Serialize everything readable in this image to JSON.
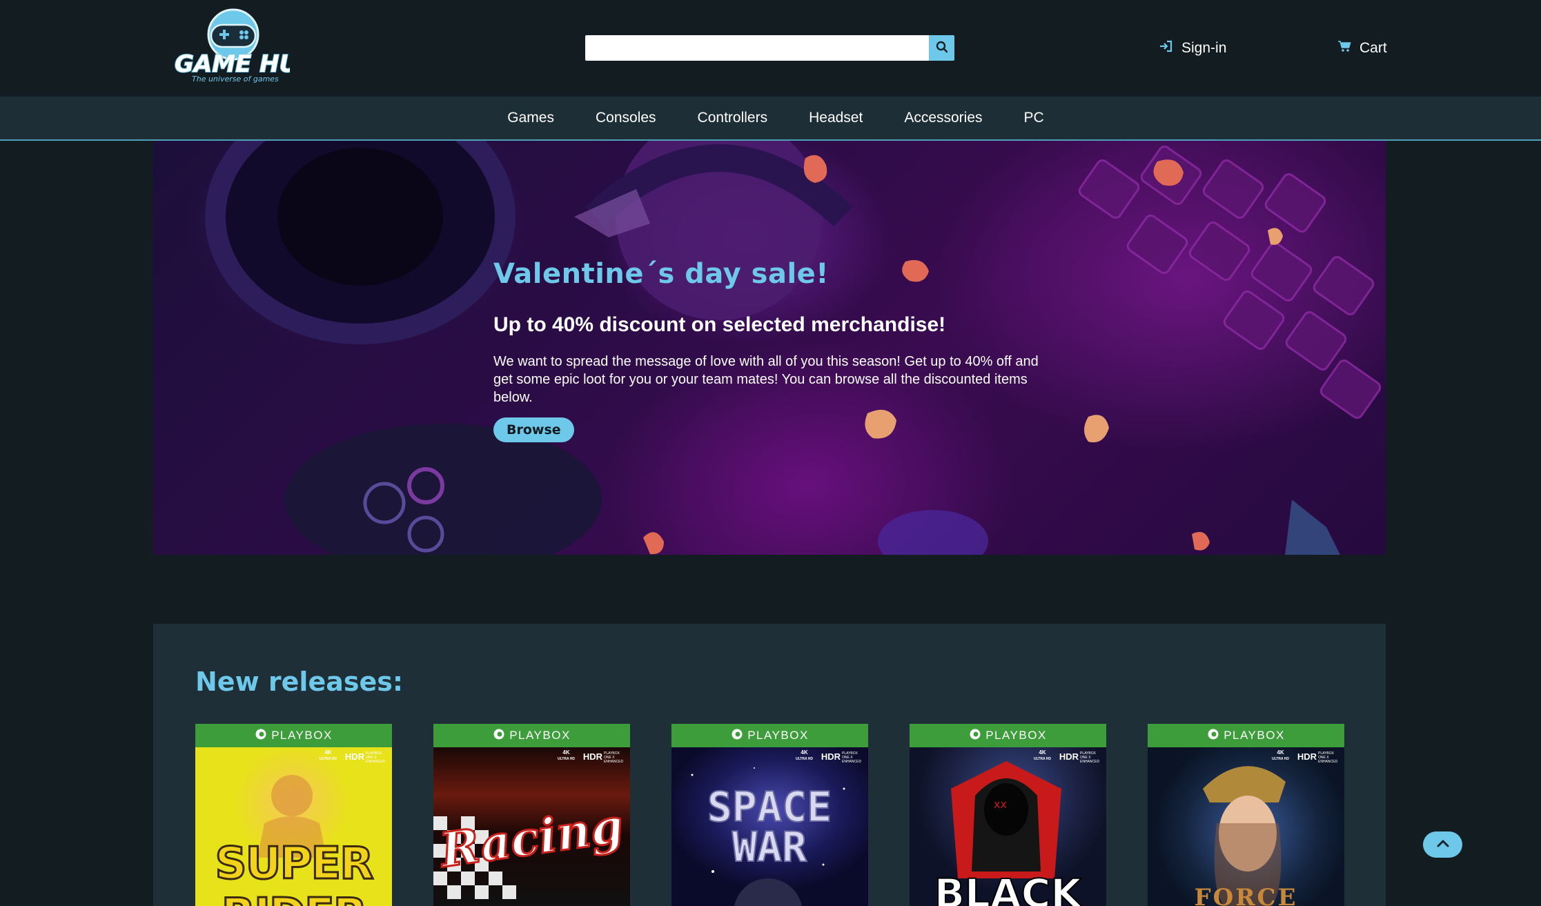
{
  "brand": {
    "name": "GAME HUB",
    "tagline": "The universe of games",
    "accent_color": "#6ec8ea"
  },
  "header": {
    "search": {
      "value": "",
      "placeholder": "",
      "icon": "search-icon"
    },
    "signin": {
      "label": "Sign-in",
      "icon": "sign-in-icon"
    },
    "cart": {
      "label": "Cart",
      "icon": "cart-icon"
    }
  },
  "nav": {
    "items": [
      "Games",
      "Consoles",
      "Controllers",
      "Headset",
      "Accessories",
      "PC"
    ]
  },
  "hero": {
    "title": "Valentine´s day sale!",
    "subtitle": "Up to 40% discount on selected merchandise!",
    "text": "We want to spread the message of love with all of you this season! Get up to 40% off and get some epic loot for you or your team mates! You can browse all the discounted items below.",
    "button": "Browse"
  },
  "releases": {
    "title": "New releases:",
    "platform_label": "PLAYBOX",
    "badge_hdr": "HDR",
    "badge_4k": "4K",
    "badge_uhd": "ULTRA HD",
    "badge_enhanced": "PLAYBOX ONE X ENHANCED",
    "platform_color": "#3c9d3a",
    "games": [
      {
        "title": "SUPER RIDER"
      },
      {
        "title": "Racing"
      },
      {
        "title": "SPACE WAR"
      },
      {
        "title": "BLACK"
      },
      {
        "title": "FORCE"
      }
    ]
  },
  "scroll_top": {
    "icon": "chevron-up-icon"
  }
}
